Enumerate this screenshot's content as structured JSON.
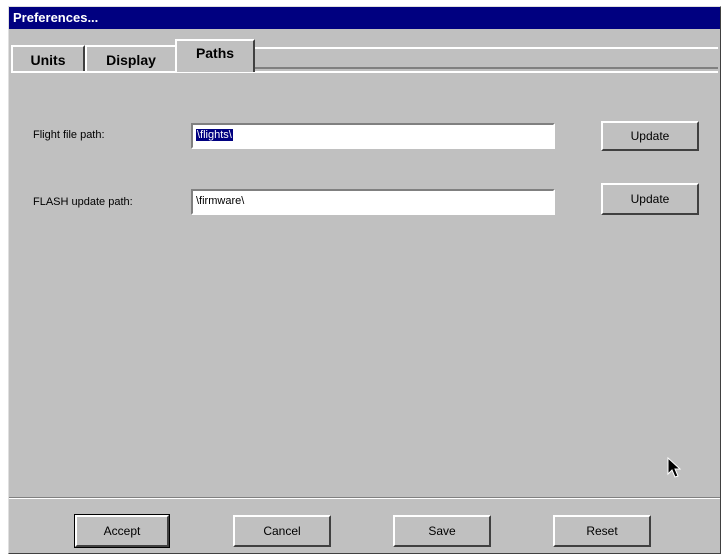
{
  "window": {
    "title": "Preferences..."
  },
  "tabs": [
    {
      "label": "Units"
    },
    {
      "label": "Display"
    },
    {
      "label": "Paths",
      "active": true
    }
  ],
  "paths": {
    "flight_file": {
      "label": "Flight file path:",
      "value": "\\flights\\",
      "button": "Update"
    },
    "flash_update": {
      "label": "FLASH update path:",
      "value": "\\firmware\\",
      "button": "Update"
    }
  },
  "buttons": {
    "accept": "Accept",
    "cancel": "Cancel",
    "save": "Save",
    "reset": "Reset"
  },
  "colors": {
    "titlebar": "#000080",
    "face": "#c0c0c0"
  }
}
